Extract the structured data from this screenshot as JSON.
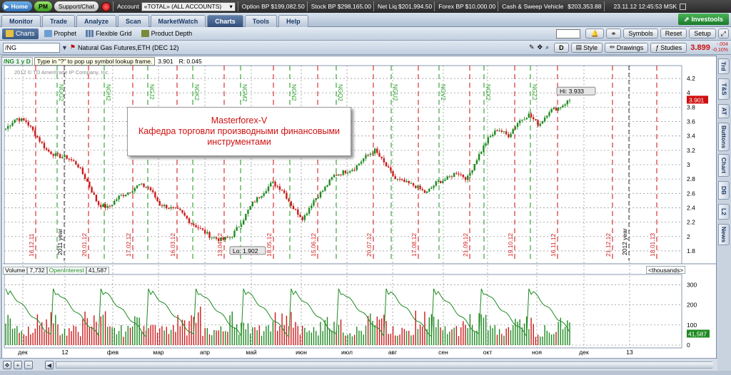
{
  "topbar": {
    "home": "Home",
    "pm": "PM",
    "support": "Support/Chat",
    "account_label": "Account",
    "account_value": "«TOTAL» (ALL ACCOUNTS)",
    "option_bp_label": "Option BP",
    "option_bp": "$199,082.50",
    "stock_bp_label": "Stock BP",
    "stock_bp": "$298,165.00",
    "net_liq_label": "Net Liq",
    "net_liq": "$201,994.50",
    "forex_bp_label": "Forex BP",
    "forex_bp": "$10,000.00",
    "cash_label": "Cash & Sweep Vehicle",
    "cash": "$203,353.88",
    "datetime": "23.11.12 12:45:53 MSK"
  },
  "tabs": {
    "items": [
      "Monitor",
      "Trade",
      "Analyze",
      "Scan",
      "MarketWatch",
      "Charts",
      "Tools",
      "Help"
    ],
    "active": "Charts",
    "investools": "Investools"
  },
  "subtabs": {
    "items": [
      "Charts",
      "Prophet",
      "Flexible Grid",
      "Product Depth"
    ],
    "active": "Charts",
    "symbols": "Symbols",
    "reset": "Reset",
    "setup": "Setup"
  },
  "symbolbar": {
    "symbol": "/NG",
    "description": "Natural Gas Futures,ETH (DEC 12)",
    "d_button": "D",
    "style": "Style",
    "drawings": "Drawings",
    "studies": "Studies",
    "last": "3.899",
    "change": "-.004",
    "change_pct": "-0.10%"
  },
  "infobar": {
    "symbol_period": "/NG 1 y D",
    "tooltip": "Type in \"?\" to pop up symbol lookup frame.",
    "close": "3.901",
    "range": "R: 0.045",
    "copyright": "2012 © TD Ameritrade IP Company, Inc."
  },
  "overlay": {
    "line1": "Masterforex-V",
    "line2": "Кафедра торговли производными финансовыми",
    "line3": "инструментами"
  },
  "volume": {
    "label": "Volume",
    "value": "7,732",
    "oi_label": "OpenInterest",
    "oi_value": "41,587",
    "units": "<thousands>"
  },
  "sidetabs": [
    "Trd",
    "T&S",
    "AT",
    "Buttons",
    "Chart",
    "DB",
    "L2",
    "News"
  ],
  "colors": {
    "up": "#1e8a22",
    "down": "#cc1a1a",
    "oi": "#1e8a22"
  },
  "chart_data": {
    "type": "candlestick",
    "price_ticks": [
      "4.2",
      "4",
      "3.8",
      "3.6",
      "3.4",
      "3.2",
      "3",
      "2.8",
      "2.6",
      "2.4",
      "2.2",
      "2",
      "1.8"
    ],
    "price_ylim": [
      1.7,
      4.3
    ],
    "last_price_label": "3.901",
    "hi_label": "Hi: 3.933",
    "lo_label": "Lo: 1.902",
    "months": [
      "дек",
      "12",
      "фев",
      "мар",
      "апр",
      "май",
      "июн",
      "июл",
      "авг",
      "сен",
      "окт",
      "ноя",
      "дек",
      "13"
    ],
    "expiry_labels_green": [
      "NGG2",
      "NGH2",
      "NGJ2",
      "NGK2",
      "NGM2",
      "NGN2",
      "NGQ2",
      "NGU2",
      "NGV2",
      "NGX2",
      "NGZ2"
    ],
    "date_labels_red": [
      "16.12.11",
      "20.01.12",
      "17.02.12",
      "16.03.12",
      "13.04.12",
      "18.05.12",
      "15.06.12",
      "20.07.12",
      "17.08.12",
      "21.09.12",
      "19.10.12",
      "16.11.12",
      "21.12.12",
      "18.01.13"
    ],
    "year_labels": [
      "2011 year",
      "2012 year"
    ],
    "close_path": [
      3.5,
      3.65,
      3.6,
      3.4,
      3.2,
      3.12,
      3.1,
      3.0,
      2.75,
      2.45,
      2.4,
      2.55,
      2.62,
      2.72,
      2.68,
      2.45,
      2.4,
      2.35,
      2.2,
      2.1,
      2.0,
      1.95,
      2.0,
      2.2,
      2.45,
      2.6,
      2.75,
      2.65,
      2.4,
      2.25,
      2.5,
      2.65,
      2.85,
      2.9,
      2.95,
      3.1,
      3.2,
      3.0,
      2.8,
      2.75,
      2.7,
      2.6,
      2.75,
      2.8,
      2.9,
      2.8,
      3.1,
      3.35,
      3.5,
      3.4,
      3.6,
      3.7,
      3.55,
      3.75,
      3.8,
      3.9
    ],
    "volume_ticks": [
      "300",
      "200",
      "100",
      "0"
    ],
    "volume_ylim": [
      0,
      340
    ],
    "oi_last_label": "41,587"
  }
}
